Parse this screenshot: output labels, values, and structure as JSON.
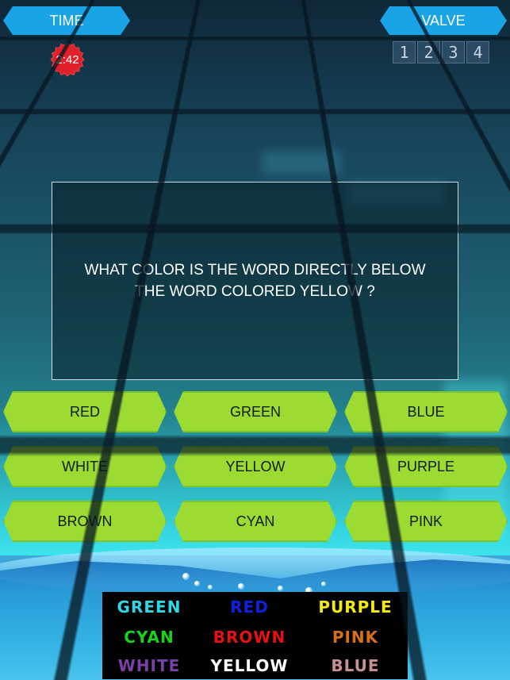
{
  "hud": {
    "time_label": "TIME",
    "timer_value": "2:42",
    "valve_label": "VALVE",
    "valve_digits": [
      "1",
      "2",
      "3",
      "4"
    ]
  },
  "question": {
    "text": "WHAT COLOR IS THE WORD DIRECTLY BELOW\nTHE WORD COLORED YELLOW ?"
  },
  "answers": [
    {
      "label": "RED"
    },
    {
      "label": "GREEN"
    },
    {
      "label": "BLUE"
    },
    {
      "label": "WHITE"
    },
    {
      "label": "YELLOW"
    },
    {
      "label": "PURPLE"
    },
    {
      "label": "BROWN"
    },
    {
      "label": "CYAN"
    },
    {
      "label": "PINK"
    }
  ],
  "board": {
    "words": [
      {
        "text": "GREEN",
        "color": "#2fd7e6"
      },
      {
        "text": "RED",
        "color": "#1020e0"
      },
      {
        "text": "PURPLE",
        "color": "#f2ea10"
      },
      {
        "text": "CYAN",
        "color": "#18d418"
      },
      {
        "text": "BROWN",
        "color": "#e81010"
      },
      {
        "text": "PINK",
        "color": "#d8701a"
      },
      {
        "text": "WHITE",
        "color": "#7a40a8"
      },
      {
        "text": "YELLOW",
        "color": "#ffffff"
      },
      {
        "text": "BLUE",
        "color": "#c89090"
      }
    ]
  },
  "colors": {
    "hud_accent": "#1aa4e8",
    "timer_badge": "#e0202a",
    "answer_button": "#9bdb32"
  }
}
